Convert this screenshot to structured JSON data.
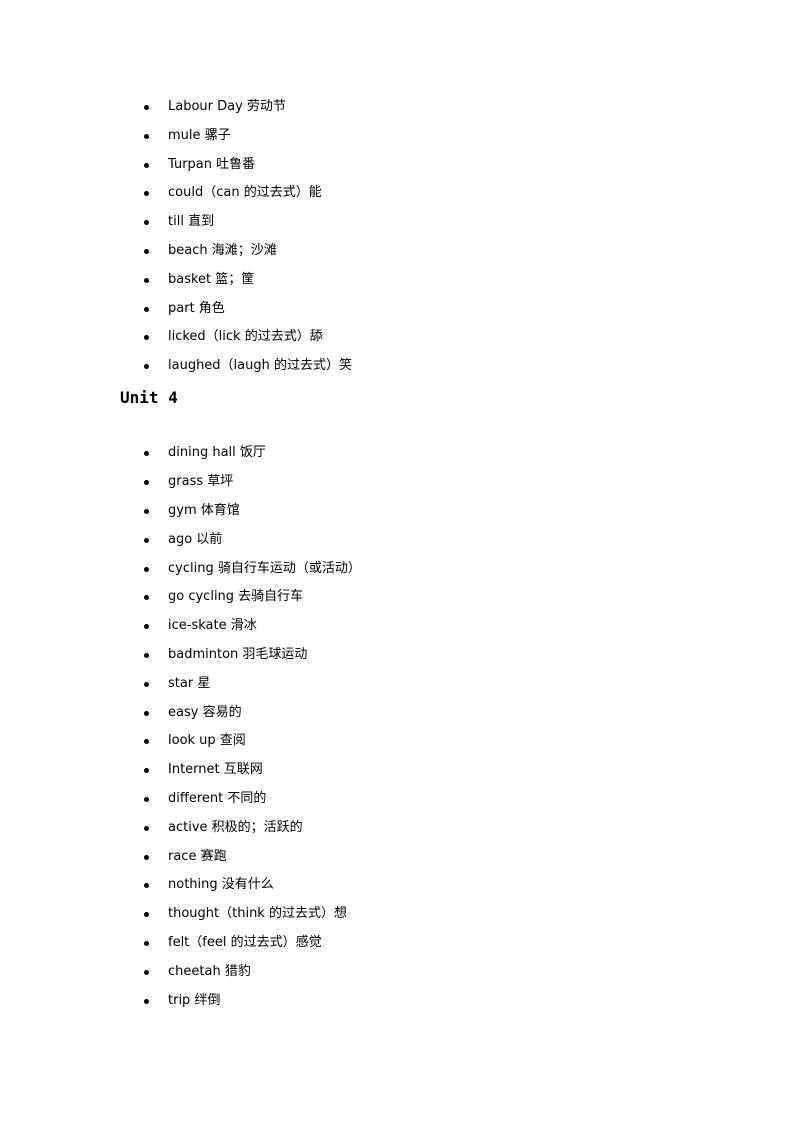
{
  "section1": {
    "items": [
      "Labour Day 劳动节",
      "mule  骡子",
      "Turpan  吐鲁番",
      "could（can  的过去式）能",
      "till  直到",
      "beach 海滩；沙滩",
      "basket 篮；筐",
      "part 角色",
      "licked（lick  的过去式）舔",
      "laughed（laugh  的过去式）笑"
    ]
  },
  "unit4": {
    "heading": "Unit 4",
    "items": [
      "dining hall  饭厅",
      "grass  草坪",
      "gym  体育馆",
      "ago 以前",
      "cycling  骑自行车运动（或活动）",
      "go cycling  去骑自行车",
      "ice-skate  滑冰",
      "badminton  羽毛球运动",
      "star  星",
      "easy 容易的",
      "look up  查阅",
      "Internet  互联网",
      "different  不同的",
      "active  积极的；活跃的",
      "race  赛跑",
      "nothing  没有什么",
      "thought（think  的过去式）想",
      "felt（feel  的过去式）感觉",
      "cheetah  猎豹",
      "trip  绊倒"
    ]
  }
}
